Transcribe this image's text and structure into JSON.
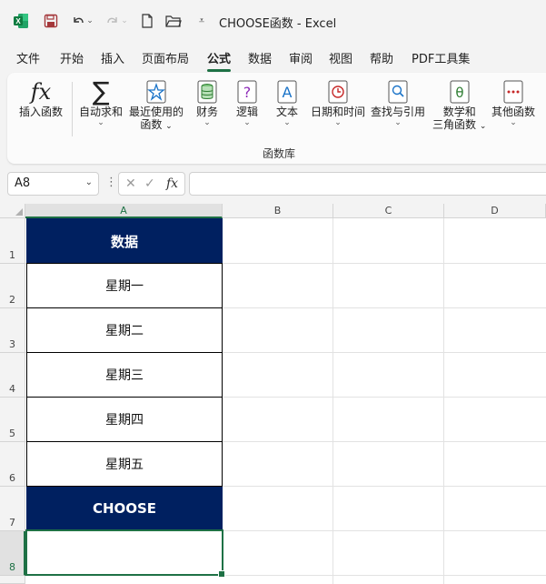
{
  "window": {
    "title": "CHOOSE函数  -  Excel"
  },
  "tabs": [
    "文件",
    "开始",
    "插入",
    "页面布局",
    "公式",
    "数据",
    "审阅",
    "视图",
    "帮助",
    "PDF工具集"
  ],
  "active_tab": "公式",
  "ribbon": {
    "insert_function": "插入函数",
    "autosum": "自动求和",
    "recent_line1": "最近使用的",
    "recent_line2": "函数",
    "financial": "财务",
    "logical": "逻辑",
    "text": "文本",
    "datetime": "日期和时间",
    "lookup": "查找与引用",
    "math_line1": "数学和",
    "math_line2": "三角函数",
    "other": "其他函数",
    "group_label": "函数库"
  },
  "formula_bar": {
    "name_box": "A8",
    "fx": "fx",
    "formula": ""
  },
  "columns": [
    "A",
    "B",
    "C",
    "D"
  ],
  "rows": [
    "1",
    "2",
    "3",
    "4",
    "5",
    "6",
    "7",
    "8"
  ],
  "cells": {
    "a1": "数据",
    "a2": "星期一",
    "a3": "星期二",
    "a4": "星期三",
    "a5": "星期四",
    "a6": "星期五",
    "a7": "CHOOSE",
    "a8": ""
  },
  "colors": {
    "header_fill": "#002060",
    "accent": "#1e7145"
  }
}
